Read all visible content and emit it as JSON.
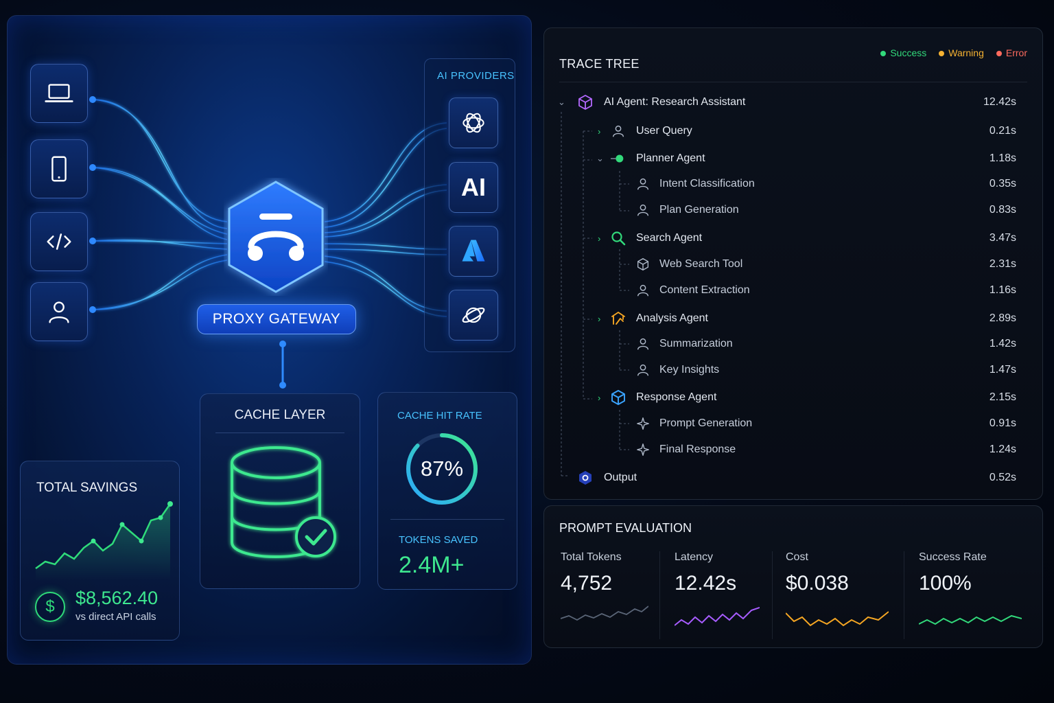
{
  "gateway": {
    "label": "PROXY GATEWAY",
    "devices": [
      "laptop-icon",
      "phone-icon",
      "code-icon",
      "user-icon"
    ],
    "providers_title": "AI PROVIDERS",
    "providers": [
      {
        "icon": "openai-icon"
      },
      {
        "icon": "ai-text-icon",
        "text": "AI"
      },
      {
        "icon": "azure-icon"
      },
      {
        "icon": "planet-icon"
      }
    ]
  },
  "cache": {
    "title": "CACHE LAYER",
    "icon": "database-check-icon"
  },
  "hit_rate": {
    "title": "CACHE HIT RATE",
    "value": "87%",
    "fraction": 0.87,
    "tokens_title": "TOKENS SAVED",
    "tokens_value": "2.4M+"
  },
  "savings": {
    "title": "TOTAL SAVINGS",
    "value": "$8,562.40",
    "subtitle": "vs direct API calls",
    "icon": "dollar-icon",
    "accent": "#3ee88f"
  },
  "trace": {
    "title": "TRACE TREE",
    "legend": [
      {
        "label": "Success",
        "color": "#32d97b"
      },
      {
        "label": "Warning",
        "color": "#f5b232"
      },
      {
        "label": "Error",
        "color": "#ff6b5e"
      }
    ],
    "rows": [
      {
        "label": "AI Agent: Research Assistant",
        "duration": "12.42s",
        "icon": "cube-purple-icon"
      },
      {
        "label": "User Query",
        "duration": "0.21s",
        "icon": "user-icon"
      },
      {
        "label": "Planner Agent",
        "duration": "1.18s",
        "icon": "status-dot-icon"
      },
      {
        "label": "Intent Classification",
        "duration": "0.35s",
        "icon": "user-icon"
      },
      {
        "label": "Plan Generation",
        "duration": "0.83s",
        "icon": "user-icon"
      },
      {
        "label": "Search Agent",
        "duration": "3.47s",
        "icon": "search-icon"
      },
      {
        "label": "Web Search Tool",
        "duration": "2.31s",
        "icon": "tool-cube-icon"
      },
      {
        "label": "Content Extraction",
        "duration": "1.16s",
        "icon": "user-icon"
      },
      {
        "label": "Analysis Agent",
        "duration": "2.89s",
        "icon": "analysis-icon"
      },
      {
        "label": "Summarization",
        "duration": "1.42s",
        "icon": "user-icon"
      },
      {
        "label": "Key Insights",
        "duration": "1.47s",
        "icon": "user-icon"
      },
      {
        "label": "Response Agent",
        "duration": "2.15s",
        "icon": "cube-blue-icon"
      },
      {
        "label": "Prompt Generation",
        "duration": "0.91s",
        "icon": "sparkle-icon"
      },
      {
        "label": "Final Response",
        "duration": "1.24s",
        "icon": "sparkle-icon"
      },
      {
        "label": "Output",
        "duration": "0.52s",
        "icon": "output-hex-icon"
      }
    ]
  },
  "evaluation": {
    "title": "PROMPT EVALUATION",
    "metrics": [
      {
        "label": "Total Tokens",
        "value": "4,752",
        "color": "#5a6577"
      },
      {
        "label": "Latency",
        "value": "12.42s",
        "color": "#a75cff"
      },
      {
        "label": "Cost",
        "value": "$0.038",
        "color": "#f5a623"
      },
      {
        "label": "Success Rate",
        "value": "100%",
        "color": "#32d97b"
      }
    ]
  }
}
